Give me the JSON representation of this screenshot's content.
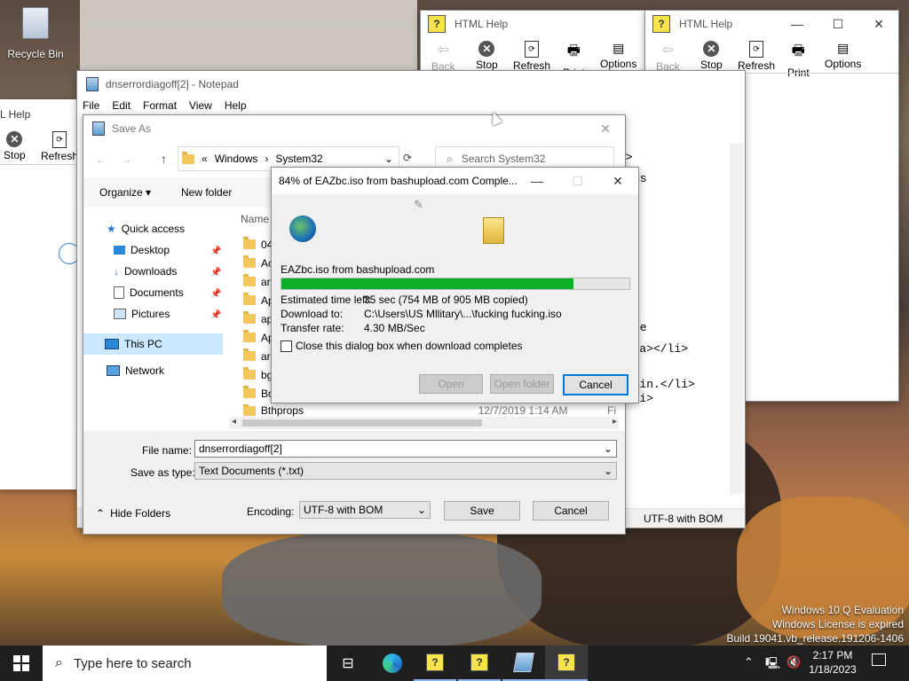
{
  "desktop": {
    "recycle_bin": "Recycle Bin"
  },
  "help_left": {
    "title_fragment": "L Help",
    "stop": "Stop",
    "refresh": "Refresh"
  },
  "help_mid": {
    "title": "HTML Help",
    "back": "Back",
    "stop": "Stop",
    "refresh": "Refresh",
    "print": "Print",
    "options": "Options"
  },
  "help_right": {
    "title": "HTML Help",
    "back": "Back",
    "stop": "Stop",
    "refresh": "Refresh",
    "print": "Print",
    "options": "Options"
  },
  "notepad": {
    "title": "dnserrordiagoff[2] - Notepad",
    "menu": [
      "File",
      "Edit",
      "Format",
      "View",
      "Help"
    ],
    "text_lines": [
      "\">",
      "as",
      "e",
      "/",
      "ge",
      "e</a></li>",
      ">",
      "ed in.</li>",
      "</li>"
    ],
    "status_encoding": "UTF-8 with BOM"
  },
  "saveas": {
    "title": "Save As",
    "breadcrumb": [
      "«",
      "Windows",
      "System32"
    ],
    "search_placeholder": "Search System32",
    "organize": "Organize",
    "new_folder": "New folder",
    "nav": {
      "quick_access": "Quick access",
      "desktop": "Desktop",
      "downloads": "Downloads",
      "documents": "Documents",
      "pictures": "Pictures",
      "this_pc": "This PC",
      "network": "Network"
    },
    "col_name": "Name",
    "files": [
      "04",
      "Ac",
      "an",
      "Ap",
      "ap",
      "Ap",
      "ar",
      "bg",
      "Bo",
      "Bthprops"
    ],
    "last_date": "12/7/2019 1:14 AM",
    "last_type": "Fi",
    "file_name_label": "File name:",
    "file_name_value": "dnserrordiagoff[2]",
    "save_type_label": "Save as type:",
    "save_type_value": "Text Documents (*.txt)",
    "hide_folders": "Hide Folders",
    "encoding_label": "Encoding:",
    "encoding_value": "UTF-8 with BOM",
    "save": "Save",
    "cancel": "Cancel"
  },
  "download": {
    "title": "84% of EAZbc.iso from bashupload.com Comple...",
    "filename_line": "EAZbc.iso from bashupload.com",
    "progress": 0.84,
    "est_label": "Estimated time left:",
    "est_value": "35 sec (754 MB of 905 MB copied)",
    "dl_to_label": "Download to:",
    "dl_to_value": "C:\\Users\\US Mllitary\\...\\fucking fucking.iso",
    "rate_label": "Transfer rate:",
    "rate_value": "4.30 MB/Sec",
    "close_checkbox": "Close this dialog box when download completes",
    "open": "Open",
    "open_folder": "Open folder",
    "cancel": "Cancel",
    "progress_color": "#06b025"
  },
  "watermark": {
    "line1": "Windows 10 Q Evaluation",
    "line2": "Windows License is expired",
    "line3": "Build 19041.vb_release.191206-1406"
  },
  "taskbar": {
    "search_placeholder": "Type here to search",
    "time": "2:17 PM",
    "date": "1/18/2023"
  }
}
